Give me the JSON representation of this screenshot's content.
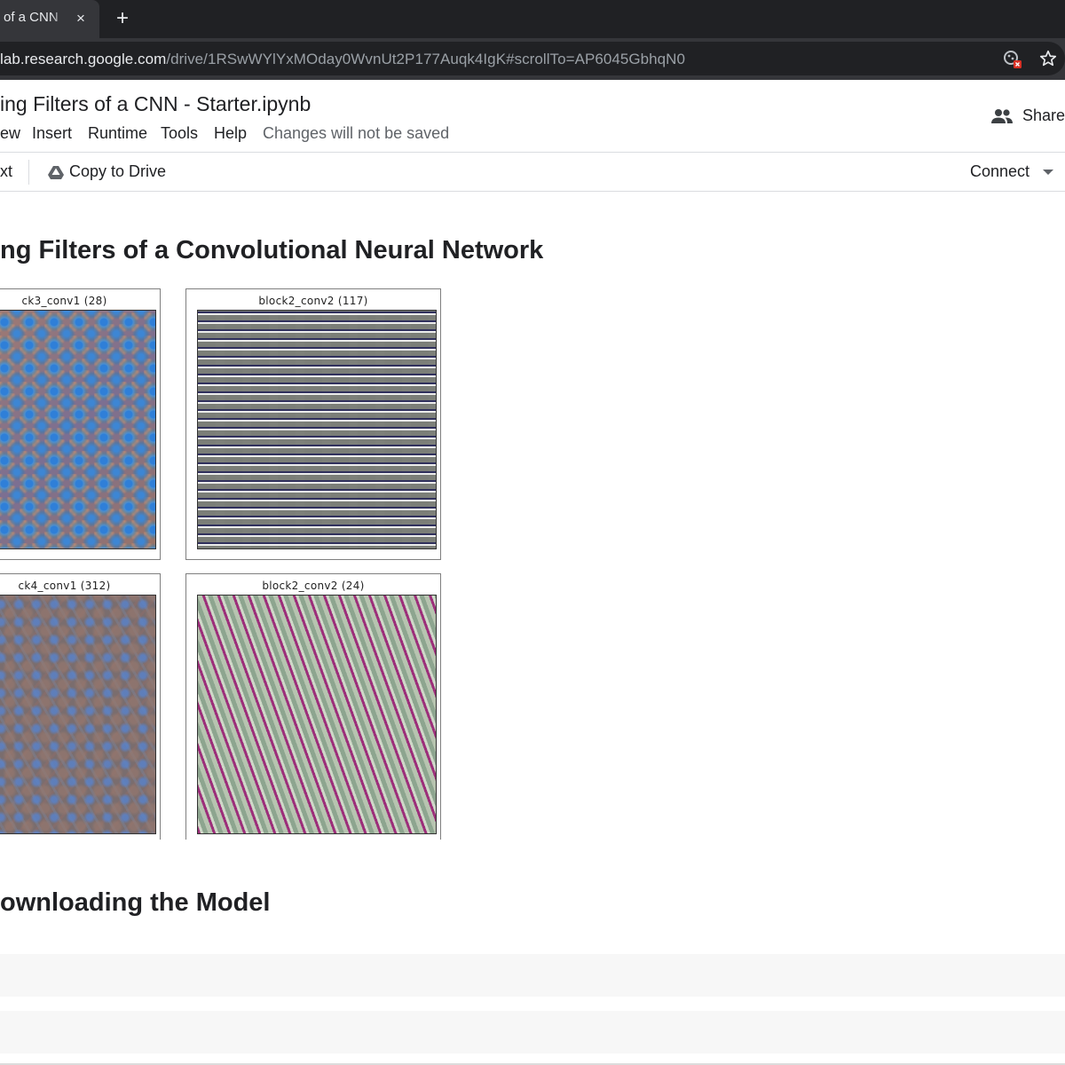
{
  "browser": {
    "tab_title": "of a CNN",
    "tab_close": "×",
    "new_tab": "+",
    "url_host": "lab.research.google.com",
    "url_path": "/drive/1RSwWYlYxMOday0WvnUt2P177Auqk4IgK#scrollTo=AP6045GbhqN0"
  },
  "notebook": {
    "title": "ing Filters of a CNN - Starter.ipynb",
    "menu": [
      "ew",
      "Insert",
      "Runtime",
      "Tools",
      "Help"
    ],
    "unsaved_notice": "Changes will not be saved",
    "share_label": "Share"
  },
  "toolbar": {
    "text_button": "xt",
    "copy_to_drive": "Copy to Drive",
    "connect": "Connect"
  },
  "content": {
    "heading_main": "ng Filters of a Convolutional Neural Network",
    "heading_sub": "ownloading the Model",
    "figures": [
      {
        "caption": "ck3_conv1 (28)"
      },
      {
        "caption": "block2_conv2 (117)"
      },
      {
        "caption": "ck4_conv1 (312)"
      },
      {
        "caption": "block2_conv2 (24)"
      }
    ]
  },
  "colors": {
    "tabbar_bg": "#202124",
    "tab_active_bg": "#35363a",
    "url_text": "#e8eaed",
    "url_dim": "#9aa0a6",
    "divider": "#dadce0",
    "cell_bg": "#f7f7f7"
  },
  "icons": [
    "close-icon",
    "plus-icon",
    "extension-icon",
    "star-icon",
    "people-icon",
    "drive-icon",
    "chevron-down-icon"
  ]
}
